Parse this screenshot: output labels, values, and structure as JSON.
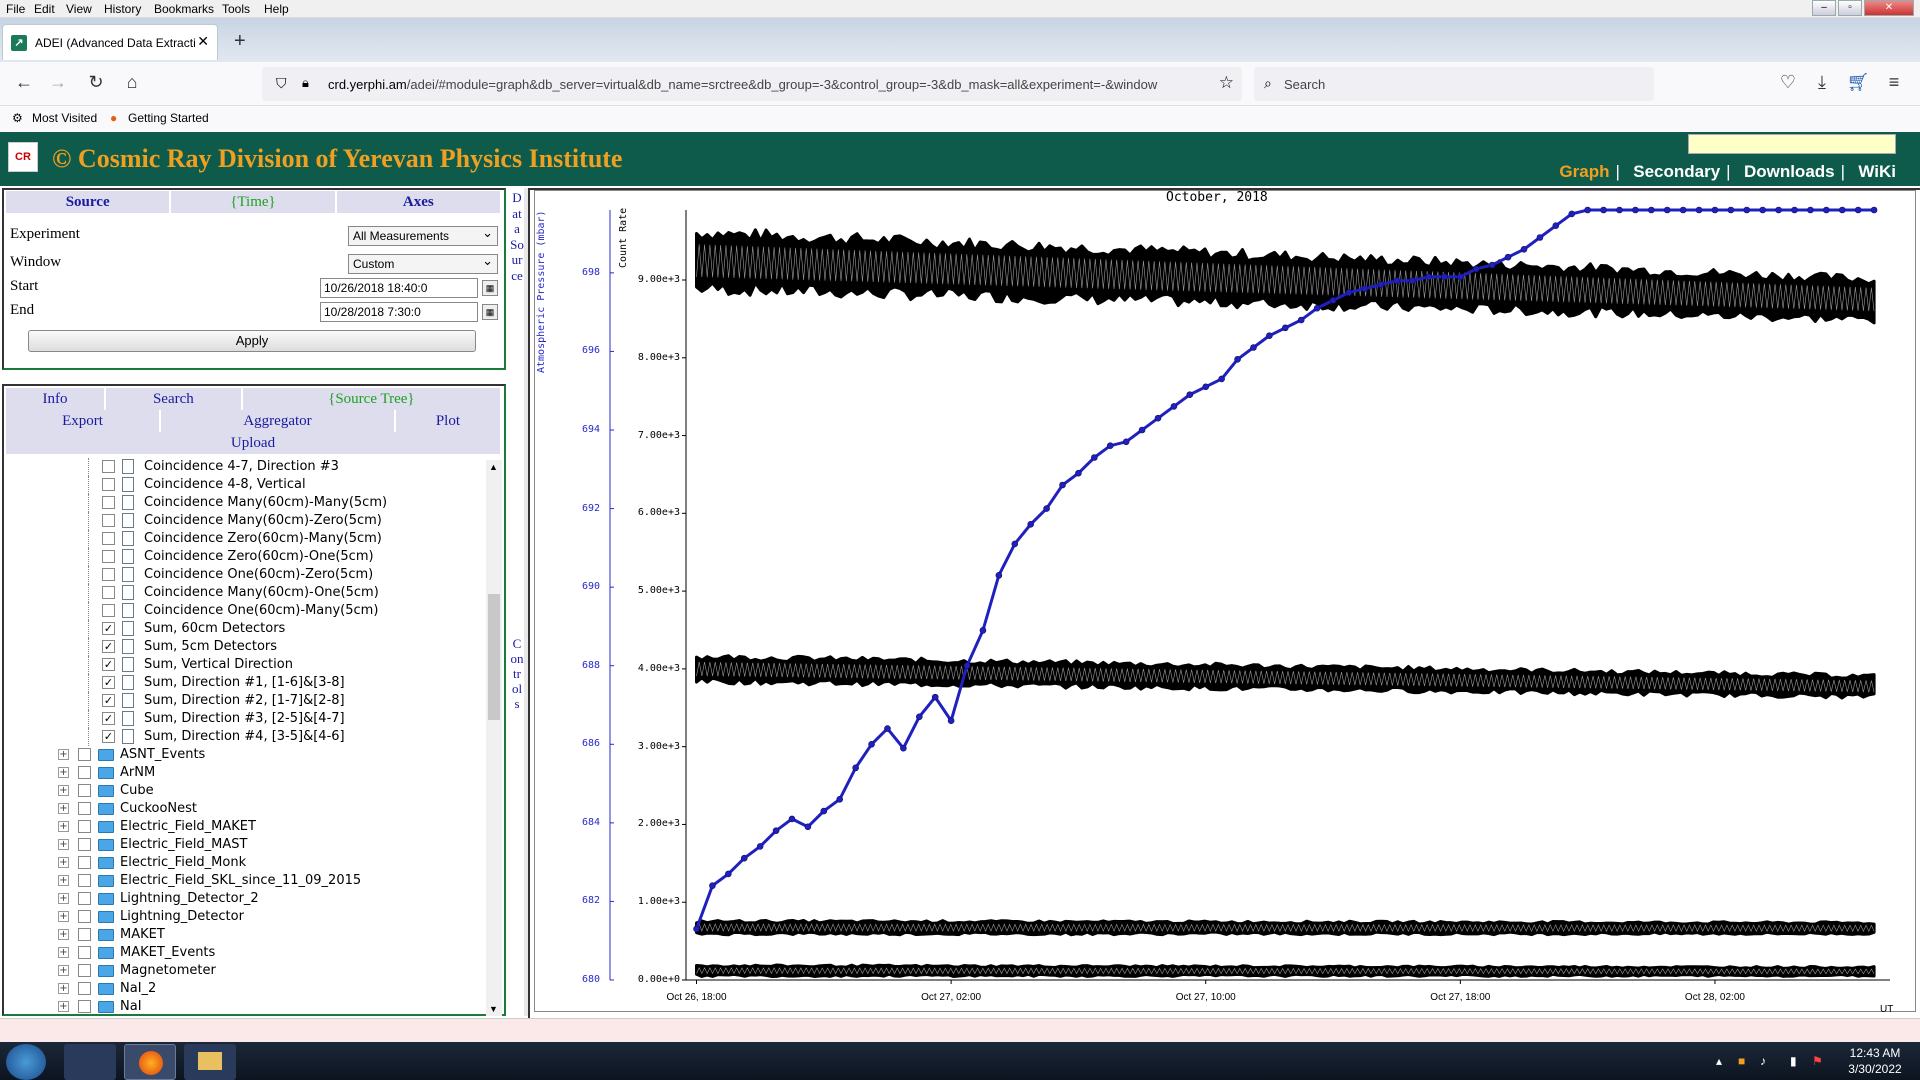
{
  "menubar": {
    "items": [
      "File",
      "Edit",
      "View",
      "History",
      "Bookmarks",
      "Tools",
      "Help"
    ]
  },
  "tab": {
    "title": "ADEI (Advanced Data Extraction"
  },
  "navbar": {
    "url_host": "crd.yerphi.am",
    "url_path": "/adei/#module=graph&db_server=virtual&db_name=srctree&db_group=-3&control_group=-3&db_mask=all&experiment=-&window",
    "search_placeholder": "Search"
  },
  "bookmarks": {
    "items": [
      "Most Visited",
      "Getting Started"
    ]
  },
  "site": {
    "title": "© Cosmic Ray Division of Yerevan Physics Institute",
    "nav": [
      "Graph",
      "Secondary",
      "Downloads",
      "WiKi"
    ],
    "active_nav": "Graph"
  },
  "source_panel": {
    "tabs": [
      "Source",
      "{Time}",
      "Axes"
    ],
    "experiment_label": "Experiment",
    "experiment_value": "All Measurements",
    "window_label": "Window",
    "window_value": "Custom",
    "start_label": "Start",
    "start_value": "10/26/2018 18:40:0",
    "end_label": "End",
    "end_value": "10/28/2018 7:30:0",
    "apply_label": "Apply",
    "vertical_label": "Data Source"
  },
  "controls_panel": {
    "tabs_row1": [
      "Info",
      "Search",
      "{Source Tree}"
    ],
    "tabs_row2": [
      "Export",
      "Aggregator",
      "Plot"
    ],
    "tabs_row3": [
      "Upload"
    ],
    "vertical_label": "Controls",
    "tree_items": [
      {
        "label": "Coincidence 4-7, Direction #3",
        "type": "doc",
        "checked": false
      },
      {
        "label": "Coincidence 4-8, Vertical",
        "type": "doc",
        "checked": false
      },
      {
        "label": "Coincidence Many(60cm)-Many(5cm)",
        "type": "doc",
        "checked": false
      },
      {
        "label": "Coincidence Many(60cm)-Zero(5cm)",
        "type": "doc",
        "checked": false
      },
      {
        "label": "Coincidence Zero(60cm)-Many(5cm)",
        "type": "doc",
        "checked": false
      },
      {
        "label": "Coincidence Zero(60cm)-One(5cm)",
        "type": "doc",
        "checked": false
      },
      {
        "label": "Coincidence One(60cm)-Zero(5cm)",
        "type": "doc",
        "checked": false
      },
      {
        "label": "Coincidence Many(60cm)-One(5cm)",
        "type": "doc",
        "checked": false
      },
      {
        "label": "Coincidence One(60cm)-Many(5cm)",
        "type": "doc",
        "checked": false
      },
      {
        "label": "Sum, 60cm Detectors",
        "type": "doc",
        "checked": true
      },
      {
        "label": "Sum, 5cm Detectors",
        "type": "doc",
        "checked": true
      },
      {
        "label": "Sum, Vertical Direction",
        "type": "doc",
        "checked": true
      },
      {
        "label": "Sum, Direction #1, [1-6]&[3-8]",
        "type": "doc",
        "checked": true
      },
      {
        "label": "Sum, Direction #2, [1-7]&[2-8]",
        "type": "doc",
        "checked": true
      },
      {
        "label": "Sum, Direction #3, [2-5]&[4-7]",
        "type": "doc",
        "checked": true
      },
      {
        "label": "Sum, Direction #4, [3-5]&[4-6]",
        "type": "doc",
        "checked": true
      },
      {
        "label": "ASNT_Events",
        "type": "folder",
        "checked": false
      },
      {
        "label": "ArNM",
        "type": "folder",
        "checked": false
      },
      {
        "label": "Cube",
        "type": "folder",
        "checked": false
      },
      {
        "label": "CuckooNest",
        "type": "folder",
        "checked": false
      },
      {
        "label": "Electric_Field_MAKET",
        "type": "folder",
        "checked": false
      },
      {
        "label": "Electric_Field_MAST",
        "type": "folder",
        "checked": false
      },
      {
        "label": "Electric_Field_Monk",
        "type": "folder",
        "checked": false
      },
      {
        "label": "Electric_Field_SKL_since_11_09_2015",
        "type": "folder",
        "checked": false
      },
      {
        "label": "Lightning_Detector_2",
        "type": "folder",
        "checked": false
      },
      {
        "label": "Lightning_Detector",
        "type": "folder",
        "checked": false
      },
      {
        "label": "MAKET",
        "type": "folder",
        "checked": false
      },
      {
        "label": "MAKET_Events",
        "type": "folder",
        "checked": false
      },
      {
        "label": "Magnetometer",
        "type": "folder",
        "checked": false
      },
      {
        "label": "NaI_2",
        "type": "folder",
        "checked": false
      },
      {
        "label": "NaI",
        "type": "folder",
        "checked": false
      }
    ]
  },
  "graph": {
    "title": "October, 2018",
    "count_axis_label": "Count Rate",
    "pressure_axis_label": "Atmospheric Pressure (mbar)",
    "timezone": "UT"
  },
  "taskbar": {
    "time": "12:43 AM",
    "date": "3/30/2022"
  },
  "chart_data": {
    "type": "line",
    "title": "October, 2018",
    "x_ticks": [
      "Oct 26, 18:00",
      "Oct 27, 02:00",
      "Oct 27, 10:00",
      "Oct 27, 18:00",
      "Oct 28, 02:00"
    ],
    "x_range_hours": [
      -0.33,
      37.5
    ],
    "y_left_label": "Count Rate",
    "y_left_ticks": [
      "0.00e+0",
      "1.00e+3",
      "2.00e+3",
      "3.00e+3",
      "4.00e+3",
      "5.00e+3",
      "6.00e+3",
      "7.00e+3",
      "8.00e+3",
      "9.00e+3"
    ],
    "y_left_range": [
      0,
      9900
    ],
    "y_right_label": "Atmospheric Pressure (mbar)",
    "y_right_ticks": [
      "680",
      "682",
      "684",
      "686",
      "688",
      "690",
      "692",
      "694",
      "696",
      "698"
    ],
    "y_right_range": [
      680,
      699.6
    ],
    "series": [
      {
        "color": "#000000",
        "axis": "count",
        "band_start": [
          8900,
          9600
        ],
        "band_end": [
          8500,
          9000
        ]
      },
      {
        "color": "#000000",
        "axis": "count",
        "band_start": [
          3850,
          4150
        ],
        "band_end": [
          3650,
          3900
        ]
      },
      {
        "color": "#000000",
        "axis": "count",
        "band_start": [
          600,
          750
        ],
        "band_end": [
          600,
          730
        ]
      },
      {
        "color": "#000000",
        "axis": "count",
        "band_start": [
          60,
          180
        ],
        "band_end": [
          60,
          160
        ]
      },
      {
        "color": "#2020c0",
        "axis": "pressure",
        "x": [
          0,
          0.5,
          1,
          1.5,
          2,
          2.5,
          3,
          3.5,
          4,
          4.5,
          5,
          5.5,
          6,
          6.5,
          7,
          7.5,
          8,
          8.5,
          9,
          9.5,
          10,
          10.5,
          11,
          11.5,
          12,
          12.5,
          13,
          13.5,
          14,
          14.5,
          15,
          15.5,
          16,
          16.5,
          17,
          17.5,
          18,
          18.5,
          19,
          19.5,
          20,
          20.5,
          21,
          21.5,
          22,
          22.5,
          23,
          23.5,
          24,
          24.5,
          25,
          25.5,
          26,
          26.5,
          27,
          27.5,
          28,
          28.5,
          29,
          29.5,
          30,
          30.5,
          31,
          31.5,
          32,
          32.5,
          33,
          33.5,
          34,
          34.5,
          35,
          35.5,
          36,
          36.5,
          37
        ],
        "y": [
          681.3,
          682.4,
          682.7,
          683.1,
          683.4,
          683.8,
          684.1,
          683.9,
          684.3,
          684.6,
          685.4,
          686.0,
          686.4,
          685.9,
          686.7,
          687.2,
          686.6,
          688.0,
          688.9,
          690.3,
          691.1,
          691.6,
          692.0,
          692.6,
          692.9,
          693.3,
          693.6,
          693.7,
          694.0,
          694.3,
          694.6,
          694.9,
          695.1,
          695.3,
          695.8,
          696.1,
          696.4,
          696.6,
          696.8,
          697.1,
          697.3,
          697.5,
          697.6,
          697.7,
          697.8,
          697.8,
          697.9,
          697.9,
          697.9,
          698.1,
          698.2,
          698.4,
          698.6,
          698.9,
          699.2,
          699.5,
          699.6,
          699.6,
          699.6,
          699.6,
          699.6,
          699.6,
          699.6,
          699.6,
          699.6,
          699.6,
          699.6,
          699.6,
          699.6,
          699.6,
          699.6,
          699.6,
          699.6,
          699.6,
          699.6
        ]
      }
    ]
  }
}
